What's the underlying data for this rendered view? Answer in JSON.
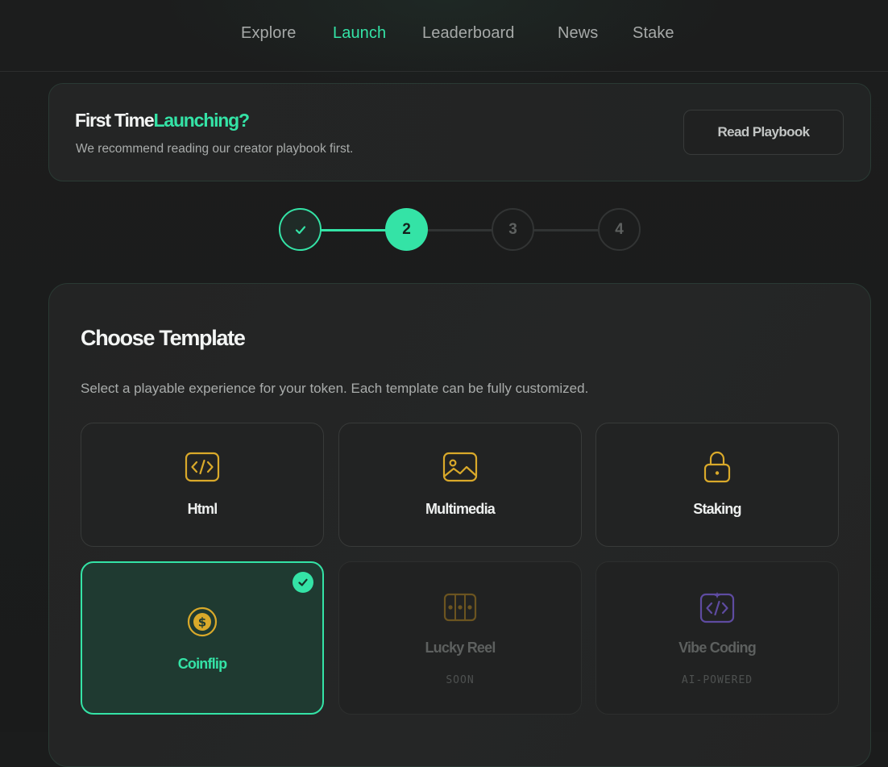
{
  "nav": {
    "items": [
      {
        "label": "Explore",
        "active": false
      },
      {
        "label": "Launch",
        "active": true
      },
      {
        "label": "Leaderboard",
        "active": false
      },
      {
        "label": "News",
        "active": false
      },
      {
        "label": "Stake",
        "active": false
      }
    ]
  },
  "banner": {
    "title_plain": "First Time",
    "title_accent": "Launching?",
    "subtitle": "We recommend reading our creator playbook first.",
    "button_label": "Read Playbook"
  },
  "stepper": {
    "steps": [
      {
        "label": "",
        "state": "complete",
        "icon": "check-icon"
      },
      {
        "label": "2",
        "state": "current"
      },
      {
        "label": "3",
        "state": "pending"
      },
      {
        "label": "4",
        "state": "pending"
      }
    ]
  },
  "templates": {
    "title": "Choose Template",
    "subtitle": "Select a playable experience for your token. Each template can be fully customized.",
    "cards": [
      {
        "label": "Html",
        "icon": "code-icon",
        "state": "default"
      },
      {
        "label": "Multimedia",
        "icon": "image-icon",
        "state": "default"
      },
      {
        "label": "Staking",
        "icon": "lock-icon",
        "state": "default"
      },
      {
        "label": "Coinflip",
        "icon": "coin-icon",
        "state": "selected"
      },
      {
        "label": "Lucky Reel",
        "icon": "slot-reel-icon",
        "state": "disabled",
        "badge": "SOON"
      },
      {
        "label": "Vibe Coding",
        "icon": "vibe-code-icon",
        "state": "disabled",
        "badge": "AI-POWERED"
      }
    ]
  },
  "colors": {
    "accent": "#34e3a6",
    "icon_gold": "#d9a92a",
    "icon_purple": "#6e58b8",
    "background": "#1b1c1c"
  }
}
